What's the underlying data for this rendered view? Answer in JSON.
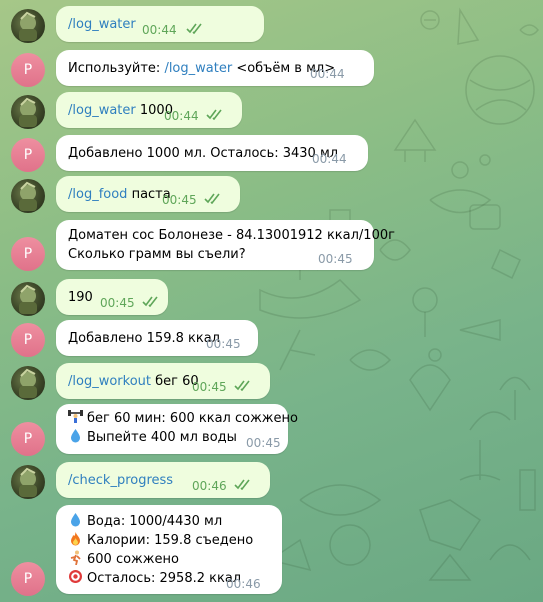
{
  "messages": [
    {
      "from": "user",
      "cmd": "/log_water",
      "arg": "",
      "time": "00:44"
    },
    {
      "from": "bot",
      "prefix": "Используйте: ",
      "cmd": "/log_water",
      "suffix": " <объём в мл>",
      "time": "00:44",
      "avatar_letter": "P"
    },
    {
      "from": "user",
      "cmd": "/log_water",
      "arg": " 1000",
      "time": "00:44"
    },
    {
      "from": "bot",
      "text": "Добавлено 1000 мл. Осталось: 3430 мл",
      "time": "00:44",
      "avatar_letter": "P"
    },
    {
      "from": "user",
      "cmd": "/log_food",
      "arg": " паста",
      "time": "00:45"
    },
    {
      "from": "bot",
      "lines": [
        "Доматен сос Болонезе - 84.13001912 ккал/100г",
        "Сколько грамм вы съели?"
      ],
      "time": "00:45",
      "avatar_letter": "P"
    },
    {
      "from": "user",
      "text": "190",
      "time": "00:45"
    },
    {
      "from": "bot",
      "text": "Добавлено 159.8 ккал",
      "time": "00:45",
      "avatar_letter": "P"
    },
    {
      "from": "user",
      "cmd": "/log_workout",
      "arg": " бег 60",
      "time": "00:45"
    },
    {
      "from": "bot",
      "lines": [
        "бег 60 мин: 600 ккал сожжено",
        "Выпейте 400 мл воды"
      ],
      "emoji": [
        "weightlifter-emoji",
        "droplet-emoji"
      ],
      "time": "00:45",
      "avatar_letter": "P"
    },
    {
      "from": "user",
      "cmd": "/check_progress",
      "arg": "",
      "time": "00:46"
    },
    {
      "from": "bot",
      "lines": [
        "Вода: 1000/4430 мл",
        "Калории: 159.8 съедено",
        "600 сожжено",
        "Осталось: 2958.2 ккал"
      ],
      "emoji": [
        "droplet-emoji",
        "fire-emoji",
        "runner-emoji",
        "target-emoji"
      ],
      "time": "00:46",
      "avatar_letter": "P"
    }
  ],
  "colors": {
    "outgoing_bubble": "#effdde",
    "incoming_bubble": "#ffffff",
    "command_link": "#2f7fbf",
    "read_checks": "#5fa659",
    "bot_avatar": "#e57f94"
  }
}
